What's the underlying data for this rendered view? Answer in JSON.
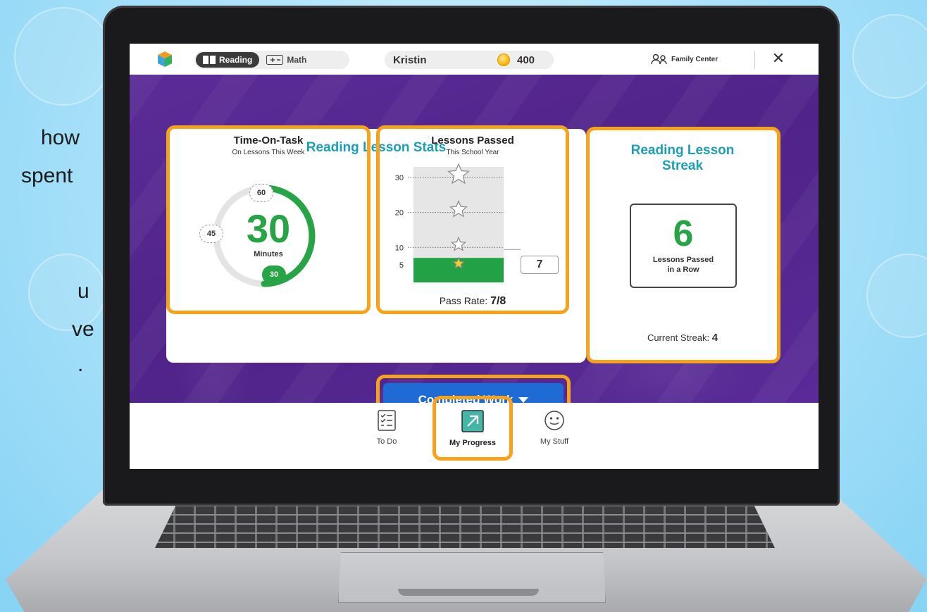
{
  "slide": {
    "side_text_lines": [
      "how",
      "spent",
      "",
      "u",
      "ve",
      "."
    ]
  },
  "app": {
    "subjects": [
      {
        "label": "Reading",
        "active": true,
        "icon": "book-icon"
      },
      {
        "label": "Math",
        "active": false,
        "icon": "plus-minus-icon"
      }
    ],
    "user_name": "Kristin",
    "coins": "400",
    "family_center_label": "Family Center",
    "close_icon": "close-icon"
  },
  "stats": {
    "title": "Reading Lesson Stats",
    "time_on_task": {
      "title": "Time-On-Task",
      "subtitle": "On Lessons This Week",
      "value": "30",
      "unit": "Minutes",
      "ticks": [
        "60",
        "45",
        "30"
      ],
      "progress_fraction": 0.5
    },
    "lessons_passed": {
      "title": "Lessons Passed",
      "subtitle": "This School Year",
      "value": 7,
      "value_label": "7",
      "pass_rate_label": "Pass Rate:",
      "pass_rate_value": "7/8"
    }
  },
  "chart_data": {
    "type": "bar",
    "categories": [
      ""
    ],
    "values": [
      7
    ],
    "title": "Lessons Passed",
    "xlabel": "",
    "ylabel": "",
    "ylim": [
      0,
      33
    ],
    "yticks": [
      5,
      10,
      20,
      30
    ],
    "star_levels": [
      5,
      10,
      20,
      30
    ],
    "colors": {
      "bar": "#23a245",
      "bg": "#e6e6e6"
    }
  },
  "streak": {
    "title_line1": "Reading Lesson",
    "title_line2": "Streak",
    "value": "6",
    "caption_line1": "Lessons Passed",
    "caption_line2": "in a Row",
    "current_label": "Current Streak:",
    "current_value": "4"
  },
  "completed_work": {
    "label": "Completed Work"
  },
  "nav": [
    {
      "label": "To Do",
      "icon": "checklist-icon",
      "active": false
    },
    {
      "label": "My Progress",
      "icon": "arrow-up-right-icon",
      "active": true
    },
    {
      "label": "My Stuff",
      "icon": "smiley-icon",
      "active": false
    }
  ],
  "colors": {
    "accent_orange": "#f7a21b",
    "teal": "#1b9fb8",
    "green": "#23a245",
    "purple": "#55288f",
    "button_blue": "#1f6bd6"
  }
}
